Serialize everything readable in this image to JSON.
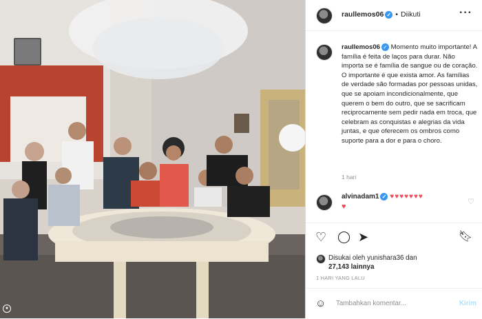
{
  "header": {
    "username": "raullemos06",
    "separator": "•",
    "follow_status": "Diikuti",
    "more": "···"
  },
  "caption": {
    "username": "raullemos06",
    "text": "Momento muito importante! A família é feita de laços para durar. Não importa se é família de sangue ou de coração. O importante é que exista amor. As famílias de verdade são formadas por pessoas unidas, que se apoiam incondicionalmente, que querem o bem do outro, que se sacrificam reciprocamente sem pedir nada em troca, que celebram as conquistas e alegrias da vida juntas, e que oferecem os ombros como suporte para a dor e para o choro.",
    "time": "1 hari"
  },
  "comment": {
    "username": "alvinadam1",
    "hearts_row1": "♥♥♥♥♥♥♥",
    "hearts_row2": "♥"
  },
  "actions": {
    "like_icon": "heart-outline-icon",
    "comment_icon": "comment-icon",
    "share_icon": "send-icon",
    "save_icon": "bookmark-icon"
  },
  "likes": {
    "line1": "Disukai oleh yunishara36 dan",
    "line2": "27,143 lainnya"
  },
  "posted": "1 HARI YANG LALU",
  "add_comment": {
    "placeholder": "Tambahkan komentar...",
    "send": "Kirim"
  },
  "colors": {
    "verified": "#3897f0",
    "heart": "#ed4956",
    "send_disabled": "#b2dffc",
    "muted": "#8e8e8e"
  }
}
